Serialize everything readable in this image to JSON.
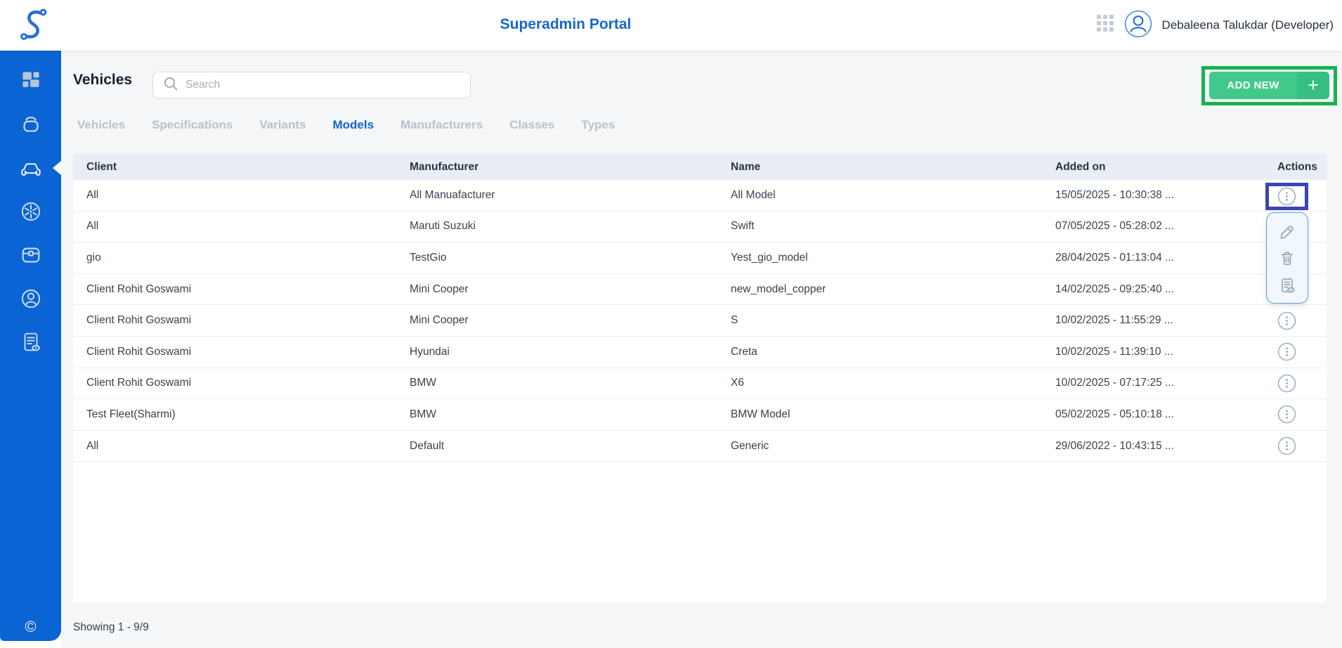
{
  "header": {
    "title": "Superadmin Portal",
    "user_name": "Debaleena Talukdar (Developer)",
    "logo_icon": "s-curve-logo",
    "apps_icon": "apps-grid-icon",
    "avatar_icon": "user-avatar-icon"
  },
  "sidebar": {
    "items": [
      {
        "icon": "dashboard-icon",
        "active": false
      },
      {
        "icon": "wallet-icon",
        "active": false
      },
      {
        "icon": "car-icon",
        "active": true
      },
      {
        "icon": "fan-icon",
        "active": false
      },
      {
        "icon": "toolbox-icon",
        "active": false
      },
      {
        "icon": "account-icon",
        "active": false
      },
      {
        "icon": "report-icon",
        "active": false
      }
    ],
    "copyright": "©"
  },
  "page": {
    "title": "Vehicles",
    "search_placeholder": "Search",
    "add_new_label": "ADD NEW",
    "add_new_plus": "+"
  },
  "tabs": [
    {
      "label": "Vehicles",
      "active": false
    },
    {
      "label": "Specifications",
      "active": false
    },
    {
      "label": "Variants",
      "active": false
    },
    {
      "label": "Models",
      "active": true
    },
    {
      "label": "Manufacturers",
      "active": false
    },
    {
      "label": "Classes",
      "active": false
    },
    {
      "label": "Types",
      "active": false
    }
  ],
  "table": {
    "columns": [
      "Client",
      "Manufacturer",
      "Name",
      "Added on",
      "Actions"
    ],
    "rows": [
      {
        "client": "All",
        "manufacturer": "All Manuafacturer",
        "name": "All Model",
        "added_on": "15/05/2025 - 10:30:38 ..."
      },
      {
        "client": "All",
        "manufacturer": "Maruti Suzuki",
        "name": "Swift",
        "added_on": "07/05/2025 - 05:28:02 ..."
      },
      {
        "client": "gio",
        "manufacturer": "TestGio",
        "name": "Yest_gio_model",
        "added_on": "28/04/2025 - 01:13:04 ..."
      },
      {
        "client": "Client Rohit Goswami",
        "manufacturer": "Mini Cooper",
        "name": "new_model_copper",
        "added_on": "14/02/2025 - 09:25:40 ..."
      },
      {
        "client": "Client Rohit Goswami",
        "manufacturer": "Mini Cooper",
        "name": "S",
        "added_on": "10/02/2025 - 11:55:29 ..."
      },
      {
        "client": "Client Rohit Goswami",
        "manufacturer": "Hyundai",
        "name": "Creta",
        "added_on": "10/02/2025 - 11:39:10 ..."
      },
      {
        "client": "Client Rohit Goswami",
        "manufacturer": "BMW",
        "name": "X6",
        "added_on": "10/02/2025 - 07:17:25 ..."
      },
      {
        "client": "Test Fleet(Sharmi)",
        "manufacturer": "BMW",
        "name": "BMW Model",
        "added_on": "05/02/2025 - 05:10:18 ..."
      },
      {
        "client": "All",
        "manufacturer": "Default",
        "name": "Generic",
        "added_on": "29/06/2022 - 10:43:15 ..."
      }
    ]
  },
  "action_menu": {
    "items": [
      {
        "icon": "edit-pencil-icon"
      },
      {
        "icon": "delete-trash-icon"
      },
      {
        "icon": "view-details-icon"
      }
    ]
  },
  "footer": {
    "showing": "Showing 1 - 9/9"
  },
  "colors": {
    "sidebar_blue": "#0b64d4",
    "title_blue": "#1767cd",
    "active_tab_blue": "#1464cf",
    "button_green": "#41c98b",
    "annotation_green": "#17b24e",
    "annotation_indigo": "#3b44b5",
    "table_header_bg": "#e9eef6"
  }
}
